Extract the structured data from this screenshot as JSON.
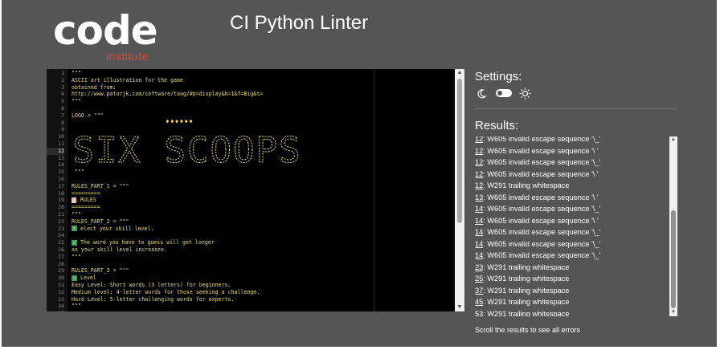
{
  "logo": {
    "word": "code",
    "sub": "institute"
  },
  "app_title": "CI Python Linter",
  "editor": {
    "active_line": "12",
    "line_numbers": [
      "1",
      "2",
      "3",
      "4",
      "5",
      "6",
      "7",
      "8",
      "9",
      "10",
      "11",
      "12",
      "13",
      "14",
      "15",
      "16",
      "17",
      "18",
      "19",
      "20",
      "21",
      "22",
      "23",
      "24",
      "25",
      "26",
      "27",
      "28",
      "29",
      "30",
      "31",
      "32",
      "33",
      "34",
      "35"
    ],
    "lines": [
      {
        "n": "1",
        "text": "\"\"\""
      },
      {
        "n": "2",
        "text": "ASCII art illustration for the game"
      },
      {
        "n": "3",
        "text": "obtained from:"
      },
      {
        "n": "4",
        "text": "http://www.patorjk.com/software/taag/#p=display&h=1&f=Big&t="
      },
      {
        "n": "5",
        "text": "\"\"\""
      },
      {
        "n": "7",
        "text": "LOGO = \"\"\""
      },
      {
        "n": "15",
        "text": " \"\"\""
      },
      {
        "n": "17",
        "text": "RULES_PART_1 = \"\"\""
      },
      {
        "n": "18",
        "text": "========="
      },
      {
        "n": "19",
        "text": "RULES"
      },
      {
        "n": "20",
        "text": "========="
      },
      {
        "n": "21",
        "text": "\"\"\""
      },
      {
        "n": "22",
        "text": "RULES_PART_2 = \"\"\""
      },
      {
        "n": "23",
        "text": "elect your skill level."
      },
      {
        "n": "25",
        "text": "The word you have to guess will get longer"
      },
      {
        "n": "26",
        "text": "as your skill level increases."
      },
      {
        "n": "27",
        "text": "\"\"\""
      },
      {
        "n": "29",
        "text": "RULES_PART_3 = \"\"\""
      },
      {
        "n": "30",
        "text": "Level"
      },
      {
        "n": "31",
        "text": "Easy Level: Short words (3 letters) for beginners."
      },
      {
        "n": "32",
        "text": "Medium level: 4-letter words for those seeking a challenge."
      },
      {
        "n": "33",
        "text": "Hard Level: 5-letter challenging words for experts."
      },
      {
        "n": "34",
        "text": "\"\"\""
      }
    ],
    "ascii_title": "SIX SCOOPS",
    "bulbs": "♦♦♦♦♦♦"
  },
  "settings": {
    "title": "Settings:",
    "moon_icon": "moon-icon",
    "sun_icon": "sun-icon"
  },
  "results": {
    "title": "Results:",
    "rows": [
      {
        "line": "12",
        "msg": ": W605 invalid escape sequence '\\_'"
      },
      {
        "line": "12",
        "msg": ": W605 invalid escape sequence '\\ '"
      },
      {
        "line": "12",
        "msg": ": W605 invalid escape sequence '\\_'"
      },
      {
        "line": "12",
        "msg": ": W605 invalid escape sequence '\\ '"
      },
      {
        "line": "12",
        "msg": ": W291 trailing whitespace"
      },
      {
        "line": "13",
        "msg": ": W605 invalid escape sequence '\\ '"
      },
      {
        "line": "14",
        "msg": ": W605 invalid escape sequence '\\_'"
      },
      {
        "line": "14",
        "msg": ": W605 invalid escape sequence '\\ '"
      },
      {
        "line": "14",
        "msg": ": W605 invalid escape sequence '\\_'"
      },
      {
        "line": "14",
        "msg": ": W605 invalid escape sequence '\\_'"
      },
      {
        "line": "14",
        "msg": ": W605 invalid escape sequence '\\_'"
      },
      {
        "line": "23",
        "msg": ": W291 trailing whitespace"
      },
      {
        "line": "25",
        "msg": ": W291 trailing whitespace"
      },
      {
        "line": "37",
        "msg": ": W291 trailing whitespace"
      },
      {
        "line": "45",
        "msg": ": W291 trailing whitespace"
      },
      {
        "line": "53",
        "msg": ": W291 trailing whitespace"
      }
    ],
    "hint": "Scroll the results to see all errors"
  }
}
